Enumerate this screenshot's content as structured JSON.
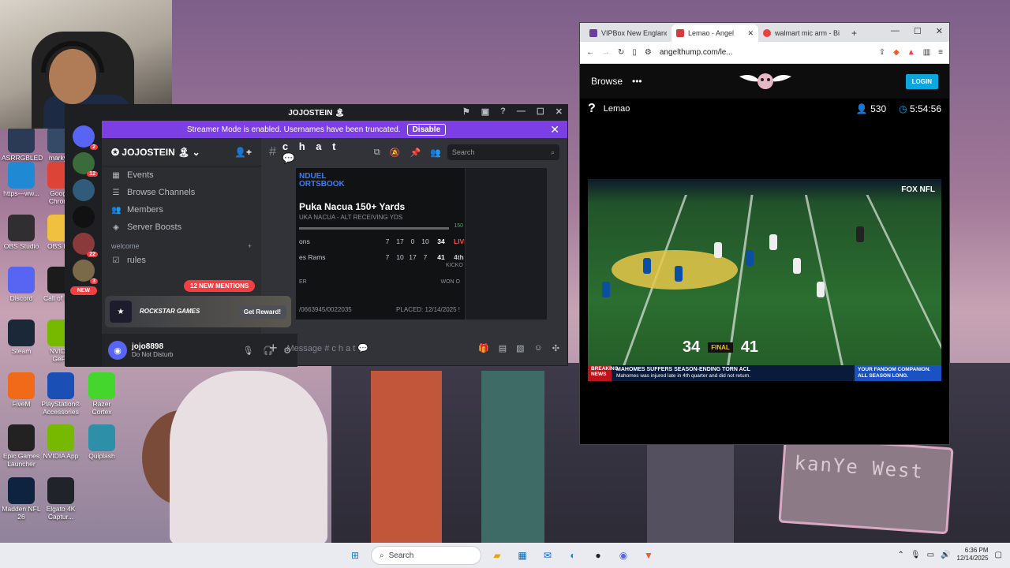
{
  "desktop": {
    "icons": [
      {
        "label": "ASRRGBLED",
        "color": "#2b3a55"
      },
      {
        "label": "markym",
        "color": "#354a66"
      },
      {
        "label": "https---ww...",
        "color": "#1f8ad3"
      },
      {
        "label": "Google Chrome",
        "color": "#db4437"
      },
      {
        "label": "OBS Studio",
        "color": "#302e31"
      },
      {
        "label": "OBS Lay",
        "color": "#f0c040"
      },
      {
        "label": "Discord",
        "color": "#5865f2"
      },
      {
        "label": "Call of Duty",
        "color": "#1b1b1b"
      },
      {
        "label": "Steam",
        "color": "#1b2838"
      },
      {
        "label": "NVIDIA GeFo",
        "color": "#76b900"
      },
      {
        "label": "FiveM",
        "color": "#f06a1a"
      },
      {
        "label": "PlayStation® Accessories",
        "color": "#1a4fb5"
      },
      {
        "label": "Razer Cortex",
        "color": "#44d62c"
      },
      {
        "label": "Epic Games Launcher",
        "color": "#222222"
      },
      {
        "label": "NVIDIA App",
        "color": "#76b900"
      },
      {
        "label": "Quiplash",
        "color": "#2e8fa8"
      },
      {
        "label": "Madden NFL 26",
        "color": "#0d2340"
      },
      {
        "label": "Elgato 4K Captur...",
        "color": "#20232a"
      }
    ],
    "wallpaper_sign": "kanYe West"
  },
  "discord": {
    "window_title": "JOJOSTEIN 🏝",
    "banner_text": "Streamer Mode is enabled. Usernames have been truncated.",
    "banner_button": "Disable",
    "server_name": "JOJOSTEIN 🏝",
    "new_label": "NEW",
    "server_badges": [
      "2",
      "12",
      "",
      "",
      "22",
      "3"
    ],
    "channel_links": [
      "Events",
      "Browse Channels",
      "Members",
      "Server Boosts"
    ],
    "category": "welcome",
    "channels": [
      "rules"
    ],
    "mentions": "12 NEW MENTIONS",
    "promo": {
      "name": "ROCKSTAR GAMES",
      "button": "Get Reward!"
    },
    "user": {
      "name": "jojo8898",
      "status": "Do Not Disturb"
    },
    "channel_name": "c h a t 💬",
    "search_placeholder": "Search",
    "composer_placeholder": "Message # c h a t 💬",
    "bet": {
      "brand": "NDUEL\nORTSBOOK",
      "title": "Puka Nacua 150+ Yards",
      "subtitle": "UKA NACUA - ALT RECEIVING YDS",
      "progress_label": "150",
      "rows": [
        {
          "team": "ons",
          "q": [
            "7",
            "17",
            "0",
            "10"
          ],
          "total": "34",
          "status": "LIVE"
        },
        {
          "team": "es Rams",
          "q": [
            "7",
            "10",
            "17",
            "7"
          ],
          "total": "41",
          "status": "4th -"
        }
      ],
      "kickoff": "KICKO",
      "won_label": "WON O",
      "ticket": "/0663945/0022035",
      "placed": "PLACED: 12/14/2025 !"
    }
  },
  "browser": {
    "tabs": [
      {
        "title": "VIPBox New England",
        "color": "#6a3fa0"
      },
      {
        "title": "Lemao - Angel",
        "color": "#d83a3a",
        "active": true
      },
      {
        "title": "walmart mic arm - Bi",
        "color": "#e8433f"
      }
    ],
    "url": "angelthump.com/le...",
    "browse_label": "Browse",
    "more_label": "•••",
    "login_label": "LOGIN",
    "stream_name": "Lemao",
    "viewers": "530",
    "uptime": "5:54:56",
    "video": {
      "network": "FOX NFL",
      "score_left": "34",
      "final": "FINAL",
      "score_right": "41",
      "breaking": "BREAKING NEWS",
      "headline": "MAHOMES SUFFERS SEASON-ENDING TORN ACL",
      "subline": "Mahomes was injured late in 4th quarter and did not return.",
      "ad": "YOUR FANDOM COMPANION. ALL SEASON LONG."
    }
  },
  "taskbar": {
    "search_placeholder": "Search",
    "time": "6:36 PM",
    "date": "12/14/2025"
  }
}
